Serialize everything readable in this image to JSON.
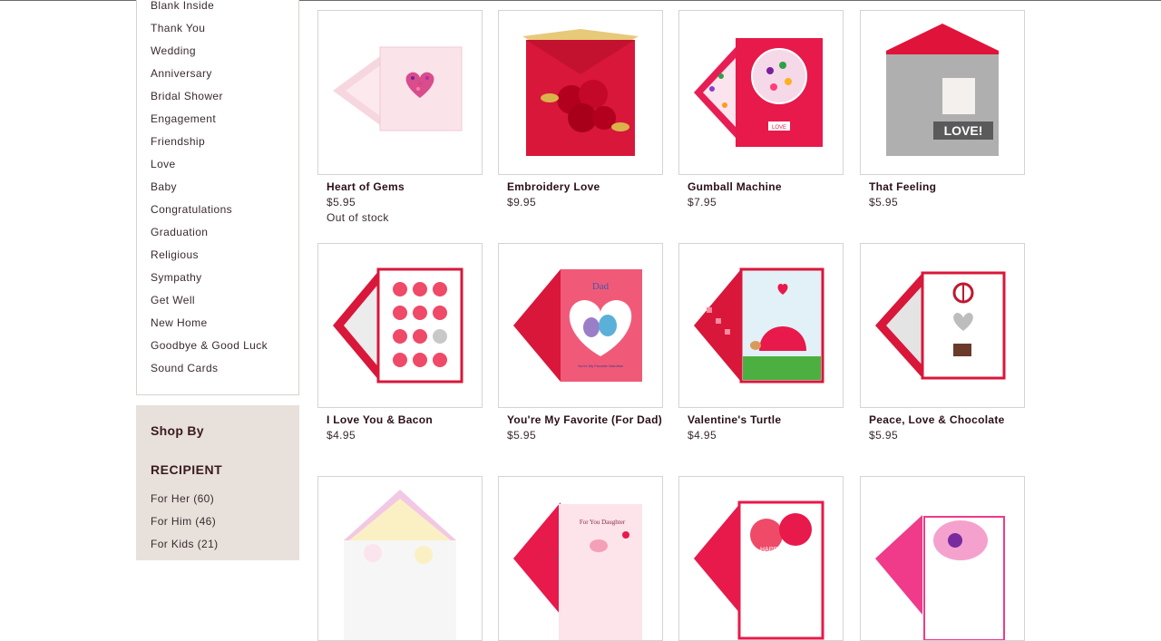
{
  "sidebar": {
    "categories": [
      "Blank Inside",
      "Thank You",
      "Wedding",
      "Anniversary",
      "Bridal Shower",
      "Engagement",
      "Friendship",
      "Love",
      "Baby",
      "Congratulations",
      "Graduation",
      "Religious",
      "Sympathy",
      "Get Well",
      "New Home",
      "Goodbye & Good Luck",
      "Sound Cards"
    ],
    "shop_by": {
      "title": "Shop By",
      "recipient_heading": "RECIPIENT",
      "recipients": [
        "For Her (60)",
        "For Him (46)",
        "For Kids (21)"
      ]
    }
  },
  "products": [
    {
      "name": "Heart of Gems",
      "price": "$5.95",
      "stock": "Out of stock",
      "thumb_icon": "pink-envelope-gem-heart-card"
    },
    {
      "name": "Embroidery Love",
      "price": "$9.95",
      "stock": "",
      "thumb_icon": "red-envelope-roses-card"
    },
    {
      "name": "Gumball Machine",
      "price": "$7.95",
      "stock": "",
      "thumb_icon": "gumball-machine-card"
    },
    {
      "name": "That Feeling",
      "price": "$5.95",
      "stock": "",
      "thumb_icon": "photo-love-card"
    },
    {
      "name": "I Love You & Bacon",
      "price": "$4.95",
      "stock": "",
      "thumb_icon": "hearts-grid-card"
    },
    {
      "name": "You're My Favorite (For Dad)",
      "price": "$5.95",
      "stock": "",
      "thumb_icon": "owls-heart-card"
    },
    {
      "name": "Valentine's Turtle",
      "price": "$4.95",
      "stock": "",
      "thumb_icon": "turtle-card"
    },
    {
      "name": "Peace, Love & Chocolate",
      "price": "$5.95",
      "stock": "",
      "thumb_icon": "peace-heart-chocolate-card"
    },
    {
      "name": "",
      "price": "",
      "stock": "",
      "thumb_icon": "yellow-envelope-card"
    },
    {
      "name": "",
      "price": "",
      "stock": "",
      "thumb_icon": "daughter-bird-card"
    },
    {
      "name": "",
      "price": "",
      "stock": "",
      "thumb_icon": "happy-vday-card"
    },
    {
      "name": "",
      "price": "",
      "stock": "",
      "thumb_icon": "watercolor-flower-card"
    }
  ],
  "card_texts": {
    "dad_title": "Dad",
    "dad_caption": "You're My Favorite Valentine",
    "love_sign": "LOVE!",
    "love_button": "LOVE",
    "daughter_text": "For You Daughter",
    "happy_vday": "HAPPY V DAY"
  },
  "colors": {
    "accent_red": "#d8173a",
    "panel_bg": "#e8e1db",
    "border": "#d4d4d4",
    "text_dark": "#2a1018"
  }
}
